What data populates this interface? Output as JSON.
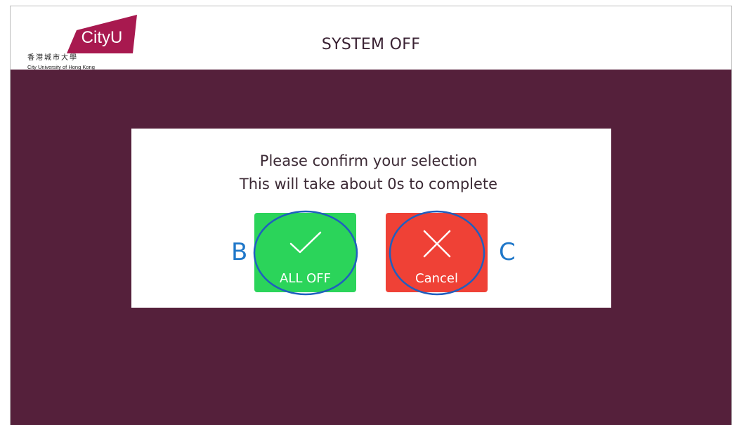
{
  "header": {
    "title": "SYSTEM OFF",
    "logo": {
      "wordmark": "CityU",
      "chinese_name": "香港城市大學",
      "english_name": "City University of Hong Kong"
    }
  },
  "dialog": {
    "line1": "Please confirm your selection",
    "line2": "This will take about 0s to complete"
  },
  "buttons": {
    "confirm": {
      "label": "ALL OFF",
      "icon": "checkmark-icon",
      "color": "#2bd45a"
    },
    "cancel": {
      "label": "Cancel",
      "icon": "close-icon",
      "color": "#ef4136"
    }
  },
  "annotations": {
    "left_letter": "B",
    "right_letter": "C",
    "color": "#1f77c9"
  },
  "colors": {
    "background": "#55203b",
    "brand": "#a8194f"
  }
}
